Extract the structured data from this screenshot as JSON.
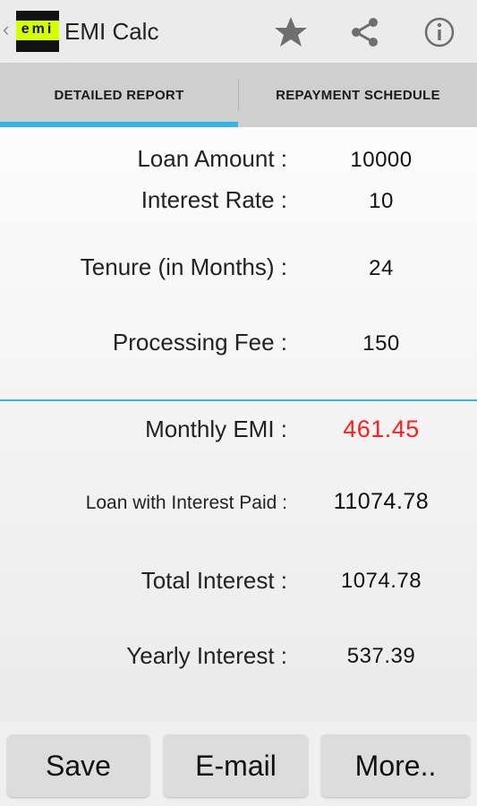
{
  "actionbar": {
    "title": "EMI Calc",
    "logo_text": "emi",
    "icons": [
      "back-caret-icon",
      "star-icon",
      "share-icon",
      "info-icon"
    ]
  },
  "tabs": [
    {
      "label": "DETAILED REPORT",
      "selected": true
    },
    {
      "label": "REPAYMENT SCHEDULE",
      "selected": false
    }
  ],
  "details": {
    "loan_amount": {
      "label": "Loan Amount :",
      "value": "10000"
    },
    "interest_rate": {
      "label": "Interest Rate :",
      "value": "10"
    },
    "tenure": {
      "label": "Tenure (in Months) :",
      "value": "24"
    },
    "processing_fee": {
      "label": "Processing Fee :",
      "value": "150"
    }
  },
  "results": {
    "monthly_emi": {
      "label": "Monthly EMI :",
      "value": "461.45"
    },
    "loan_with_interest": {
      "label": "Loan with Interest Paid :",
      "value": "11074.78"
    },
    "total_interest": {
      "label": "Total Interest :",
      "value": "1074.78"
    },
    "yearly_interest": {
      "label": "Yearly Interest :",
      "value": "537.39"
    }
  },
  "buttons": {
    "save": "Save",
    "email": "E-mail",
    "more": "More.."
  },
  "colors": {
    "accent": "#33b5e5",
    "emi_value": "#ff1d1d",
    "logo_band": "#d6ff00"
  }
}
